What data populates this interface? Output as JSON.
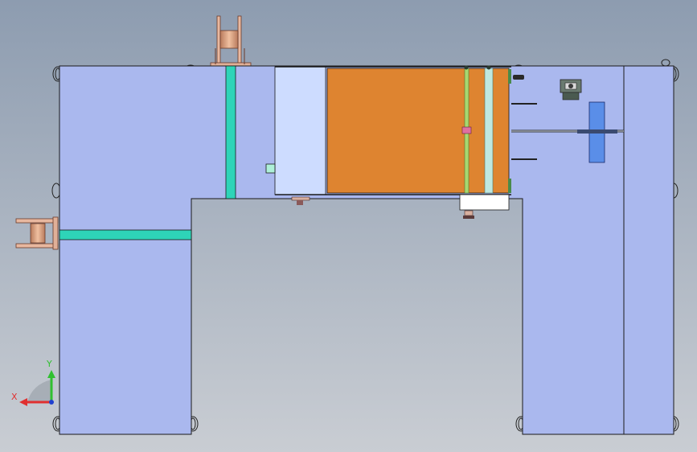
{
  "viewport": {
    "background_top": "#8d9cb0",
    "background_bottom": "#c9cdd3"
  },
  "colors": {
    "frame": "#aab8ee",
    "frame_stroke": "#1a1a1a",
    "cyan_bar": "#2ed4b8",
    "orange_block": "#de8430",
    "light_panel": "#cddcff",
    "copper": "#d9a080",
    "blue_block": "#5a8ee8",
    "glass_tube": "#bfe8e0",
    "green_tube": "#a8d870",
    "axis_x": "#e03030",
    "axis_y": "#30c030",
    "axis_z": "#2040d0"
  },
  "triad": {
    "x_label": "X",
    "y_label": "Y"
  }
}
